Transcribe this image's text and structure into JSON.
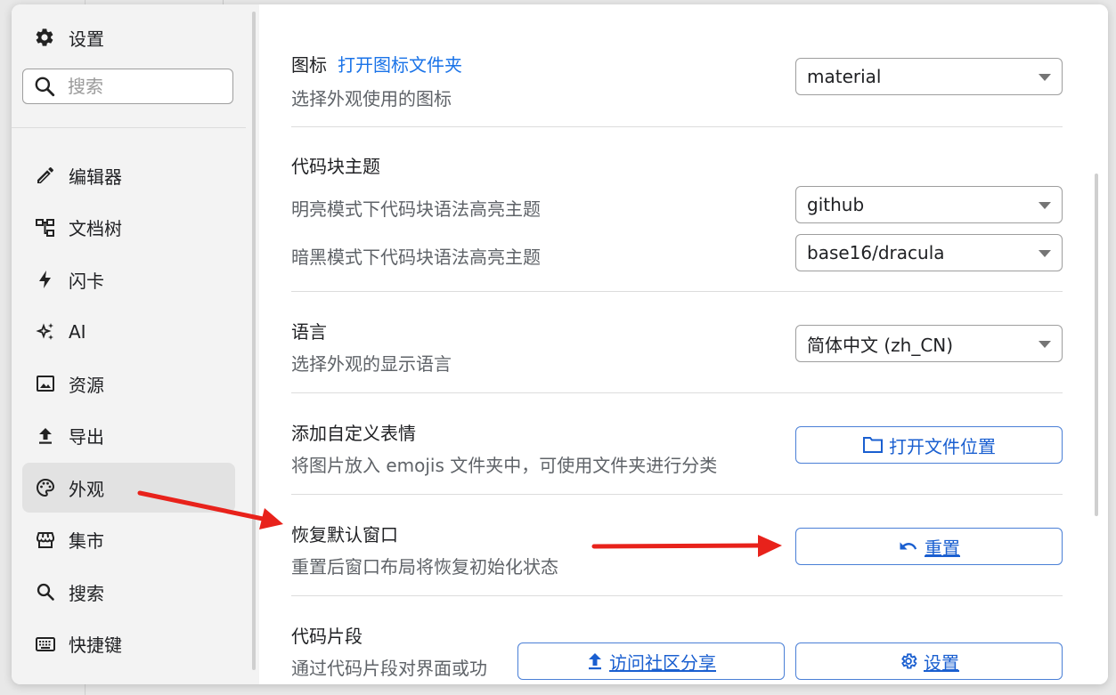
{
  "sidebar": {
    "title": "设置",
    "search_placeholder": "搜索",
    "items": [
      {
        "label": "编辑器",
        "icon": "pencil-icon"
      },
      {
        "label": "文档树",
        "icon": "tree-icon"
      },
      {
        "label": "闪卡",
        "icon": "lightning-icon"
      },
      {
        "label": "AI",
        "icon": "sparkle-icon"
      },
      {
        "label": "资源",
        "icon": "image-icon"
      },
      {
        "label": "导出",
        "icon": "upload-icon"
      },
      {
        "label": "外观",
        "icon": "palette-icon",
        "active": true
      },
      {
        "label": "集市",
        "icon": "store-icon"
      },
      {
        "label": "搜索",
        "icon": "search-icon"
      },
      {
        "label": "快捷键",
        "icon": "keyboard-icon"
      }
    ]
  },
  "main": {
    "icon_section": {
      "title": "图标",
      "link": "打开图标文件夹",
      "desc": "选择外观使用的图标",
      "value": "material"
    },
    "code_theme": {
      "title": "代码块主题",
      "light_label": "明亮模式下代码块语法高亮主题",
      "light_value": "github",
      "dark_label": "暗黑模式下代码块语法高亮主题",
      "dark_value": "base16/dracula"
    },
    "language": {
      "title": "语言",
      "desc": "选择外观的显示语言",
      "value": "简体中文 (zh_CN)"
    },
    "emoji": {
      "title": "添加自定义表情",
      "desc": "将图片放入 emojis 文件夹中，可使用文件夹进行分类",
      "button": "打开文件位置"
    },
    "reset_window": {
      "title": "恢复默认窗口",
      "desc": "重置后窗口布局将恢复初始化状态",
      "button": "重置"
    },
    "snippets": {
      "title": "代码片段",
      "desc": "通过代码片段对界面或功",
      "share_button": "访问社区分享",
      "settings_button": "设置"
    }
  },
  "colors": {
    "accent": "#1a73e8",
    "annotation": "#e8221b"
  }
}
